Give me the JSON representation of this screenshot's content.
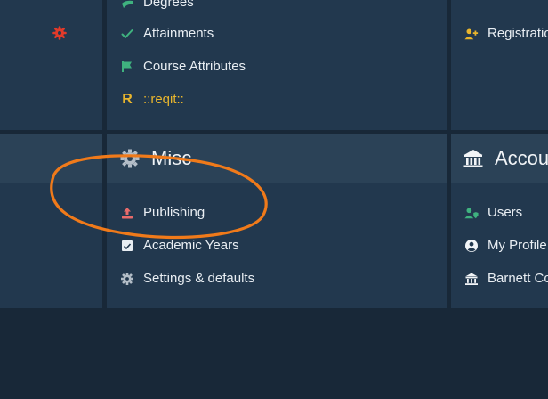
{
  "top_middle": {
    "items": [
      {
        "label": "Degrees",
        "icon": "graduation-cap-icon"
      },
      {
        "label": "Attainments",
        "icon": "check-icon"
      },
      {
        "label": "Course Attributes",
        "icon": "flag-icon"
      },
      {
        "label": "::reqit::",
        "icon": "r-letter-icon",
        "icon_text": "R"
      }
    ]
  },
  "top_right": {
    "items": [
      {
        "label": "Registratio",
        "icon": "user-plus-icon"
      }
    ]
  },
  "misc": {
    "title": "Misc",
    "items": [
      {
        "label": "Publishing",
        "icon": "upload-icon"
      },
      {
        "label": "Academic Years",
        "icon": "calendar-check-icon"
      },
      {
        "label": "Settings & defaults",
        "icon": "gear-icon"
      }
    ]
  },
  "accounts": {
    "title": "Accou",
    "items": [
      {
        "label": "Users",
        "icon": "user-shield-icon"
      },
      {
        "label": "My Profile",
        "icon": "user-circle-icon"
      },
      {
        "label": "Barnett Co",
        "icon": "bank-icon"
      }
    ]
  },
  "colors": {
    "page_bg": "#182838",
    "panel_bg": "#22384e",
    "panel_header_bg": "#2b4257",
    "annotation_orange": "#f07a1a",
    "accent_red": "#e23a2a",
    "accent_green": "#3fb27f",
    "accent_yellow": "#e8b52d"
  }
}
